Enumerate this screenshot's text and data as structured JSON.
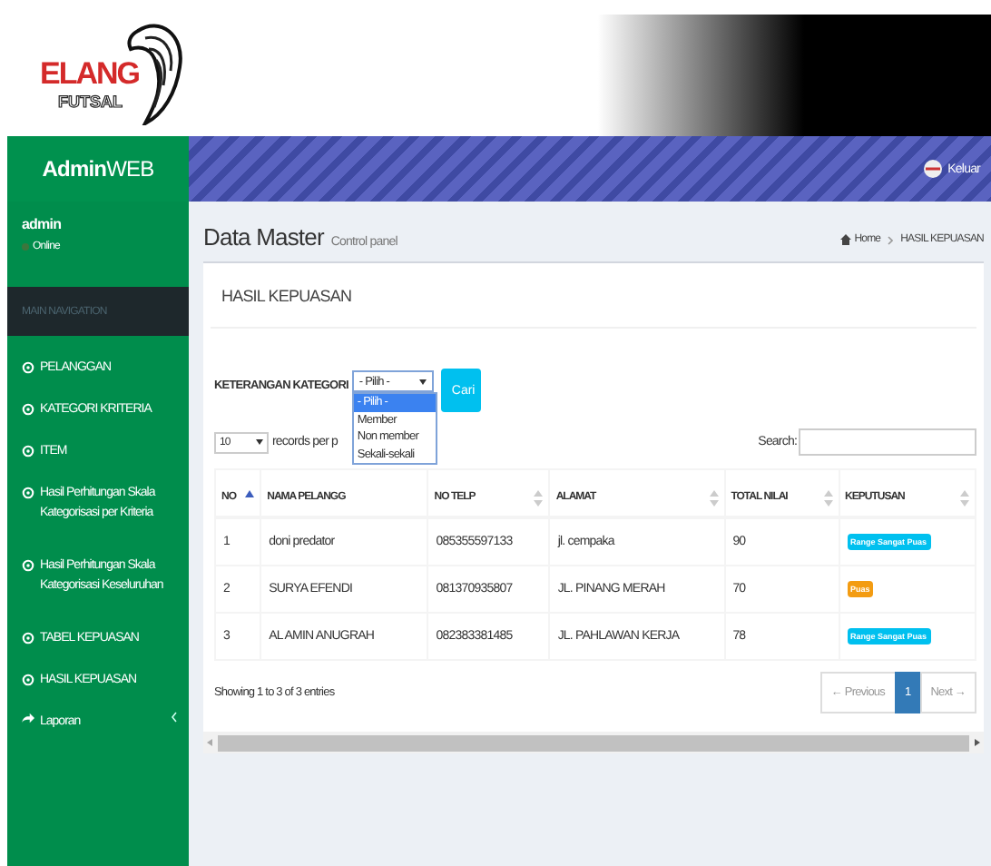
{
  "banner": {
    "logo_top": "ELANG",
    "logo_bottom": "FUTSAL"
  },
  "brand": "**Admin**WEB",
  "topbar": {
    "logout": "Keluar"
  },
  "user": {
    "name": "admin",
    "status": "Online"
  },
  "nav_header": "MAIN NAVIGATION",
  "nav_items": [
    {
      "label": "PELANGGAN",
      "kind": "circle"
    },
    {
      "label": "KATEGORI KRITERIA",
      "kind": "circle"
    },
    {
      "label": "ITEM",
      "kind": "circle"
    },
    {
      "label": "Hasil Perhitungan Skala Kategorisasi per Kriteria",
      "kind": "circle"
    },
    {
      "label": "Hasil Perhitungan Skala Kategorisasi Keseluruhan",
      "kind": "circle"
    },
    {
      "label": "TABEL KEPUASAN",
      "kind": "circle"
    },
    {
      "label": "HASIL KEPUASAN",
      "kind": "circle"
    },
    {
      "label": "Laporan",
      "kind": "submenu"
    }
  ],
  "page_header": {
    "title": "Data Master",
    "subtitle": "Control panel",
    "breadcrumb": [
      "Home",
      "HASIL KEPUASAN"
    ]
  },
  "box_title": "HASIL KEPUASAN",
  "filter": {
    "label": "KETERANGAN KATEGORI",
    "value": "- Pilih -",
    "button": "Cari",
    "options": [
      {
        "label": "- Pilih -",
        "selected": true
      },
      {
        "label": "Member",
        "selected": false
      },
      {
        "label": "Non member",
        "selected": false
      },
      {
        "label": "Sekali-sekali",
        "selected": false
      }
    ]
  },
  "length": {
    "value": "10",
    "label": "records per p"
  },
  "search": {
    "label": "Search:"
  },
  "table": {
    "columns": [
      {
        "label": "NO",
        "sorted": true
      },
      {
        "label": "NAMA PELANGG"
      },
      {
        "label": "NO TELP",
        "sorted": false
      },
      {
        "label": "ALAMAT",
        "sorted": false
      },
      {
        "label": "TOTAL NILAI",
        "sorted": false
      },
      {
        "label": "KEPUTUSAN",
        "sorted": false
      }
    ],
    "rows": [
      {
        "no": "1",
        "nama": "doni predator",
        "telp": "085355597133",
        "alamat": "jl. cempaka",
        "total": "90",
        "keputusan": {
          "text": "Range Sangat Puas",
          "color": "#00c0ef"
        }
      },
      {
        "no": "2",
        "nama": "SURYA EFENDI",
        "telp": "081370935807",
        "alamat": "JL. PINANG MERAH",
        "total": "70",
        "keputusan": {
          "text": "Puas",
          "color": "#f39c12"
        }
      },
      {
        "no": "3",
        "nama": "AL AMIN ANUGRAH",
        "telp": "082383381485",
        "alamat": "JL. PAHLAWAN KERJA",
        "total": "78",
        "keputusan": {
          "text": "Range Sangat Puas",
          "color": "#00c0ef"
        }
      }
    ]
  },
  "info": "Showing 1 to 3 of 3 entries",
  "pagination": [
    {
      "label": "← Previous",
      "selected": false
    },
    {
      "label": "1",
      "selected": true
    },
    {
      "label": "Next →",
      "selected": false
    }
  ]
}
